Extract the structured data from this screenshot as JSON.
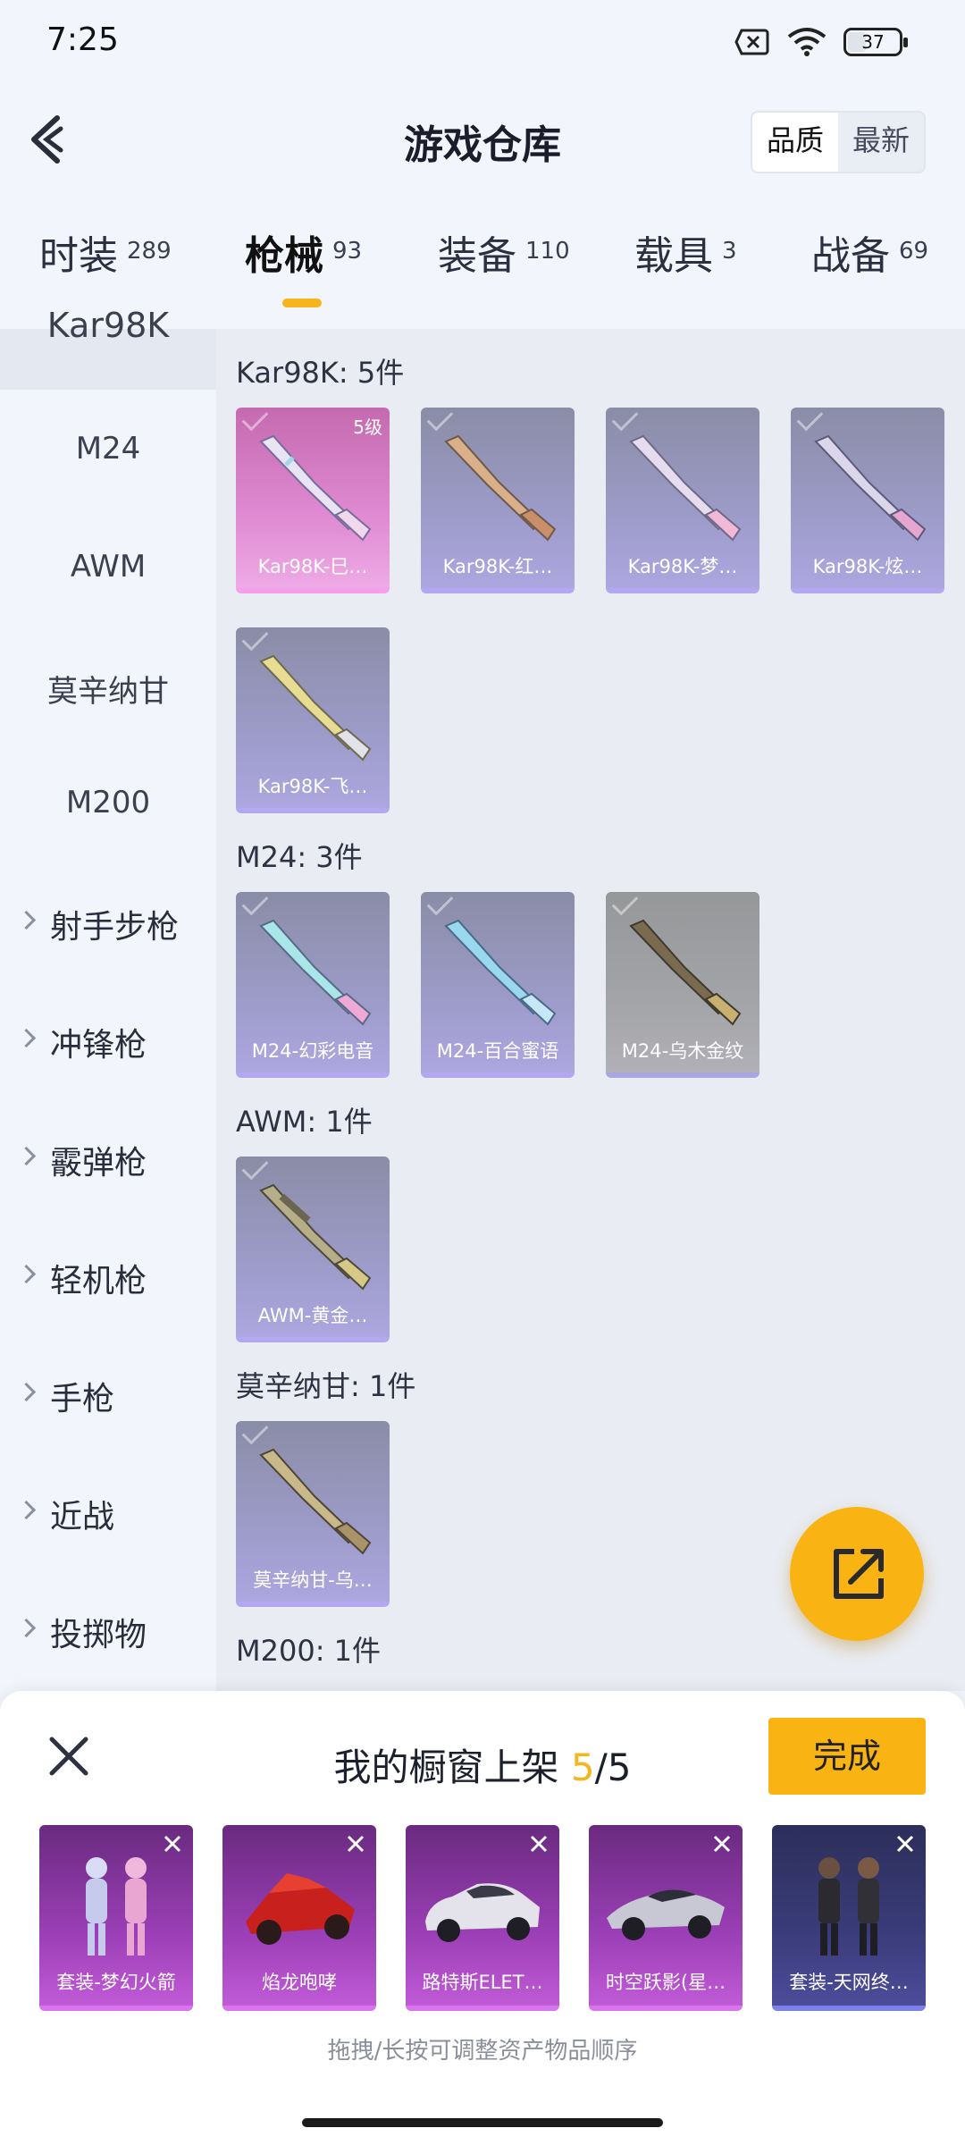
{
  "status_bar": {
    "time": "7:25",
    "battery": "37"
  },
  "header": {
    "title": "游戏仓库",
    "sort_options": [
      "品质",
      "最新"
    ],
    "active_sort": "品质"
  },
  "tabs": [
    {
      "label": "时装",
      "count": "289"
    },
    {
      "label": "枪械",
      "count": "93"
    },
    {
      "label": "装备",
      "count": "110"
    },
    {
      "label": "载具",
      "count": "3"
    },
    {
      "label": "战备",
      "count": "69"
    }
  ],
  "active_tab": "枪械",
  "sidebar": {
    "active_item": "Kar98K",
    "items": [
      "Kar98K",
      "M24",
      "AWM",
      "莫辛纳甘",
      "M200"
    ],
    "categories": [
      "射手步枪",
      "冲锋枪",
      "霰弹枪",
      "轻机枪",
      "手枪",
      "近战",
      "投掷物"
    ]
  },
  "sections": [
    {
      "title": "Kar98K: 5件",
      "items": [
        {
          "name": "Kar98K-巳…",
          "level": "5级"
        },
        {
          "name": "Kar98K-红…"
        },
        {
          "name": "Kar98K-梦…"
        },
        {
          "name": "Kar98K-炫…"
        },
        {
          "name": "Kar98K-飞…"
        }
      ]
    },
    {
      "title": "M24: 3件",
      "items": [
        {
          "name": "M24-幻彩电音"
        },
        {
          "name": "M24-百合蜜语"
        },
        {
          "name": "M24-乌木金纹"
        }
      ]
    },
    {
      "title": "AWM: 1件",
      "items": [
        {
          "name": "AWM-黄金…"
        }
      ]
    },
    {
      "title": "莫辛纳甘: 1件",
      "items": [
        {
          "name": "莫辛纳甘-乌…"
        }
      ]
    },
    {
      "title": "M200: 1件",
      "items": []
    }
  ],
  "showcase": {
    "title": "我的橱窗上架",
    "current": "5",
    "total": "/5",
    "done_label": "完成",
    "items": [
      {
        "name": "套装-梦幻火箭"
      },
      {
        "name": "焰龙咆哮"
      },
      {
        "name": "路特斯ELET…"
      },
      {
        "name": "时空跃影(星…"
      },
      {
        "name": "套装-天网终…"
      }
    ],
    "hint": "拖拽/长按可调整资产物品顺序"
  },
  "colors": {
    "accent": "#f9b414",
    "background": "#f2f5fb",
    "content_bg": "#e9ecf2"
  }
}
